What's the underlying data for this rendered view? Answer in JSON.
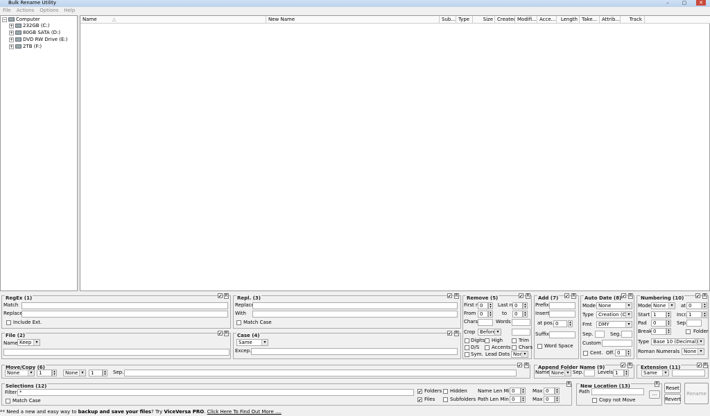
{
  "window": {
    "title": "Bulk Rename Utility",
    "controls": [
      "–",
      "▢",
      "✕"
    ]
  },
  "menu": [
    "File",
    "Actions",
    "Options",
    "Help"
  ],
  "tree": {
    "root": "Computer",
    "drives": [
      "232GB (C:)",
      "80GB SATA (D:)",
      "DVD RW Drive (E:)",
      "2TB (F:)"
    ]
  },
  "columns": [
    "Name",
    "New Name",
    "Sub...",
    "Type",
    "Size",
    "Created",
    "Modifi...",
    "Acce...",
    "Length",
    "Take...",
    "Attrib...",
    "Track"
  ],
  "regex": {
    "title": "RegEx (1)",
    "match": "Match",
    "replace": "Replace",
    "include_ext": "Include Ext."
  },
  "repl": {
    "title": "Repl. (3)",
    "replace": "Replace",
    "with": "With",
    "match_case": "Match Case"
  },
  "remove": {
    "title": "Remove (5)",
    "first_n": "First n",
    "first_val": "0",
    "last_n": "Last n",
    "last_val": "0",
    "from": "From",
    "from_val": "0",
    "to": "to",
    "to_val": "0",
    "chars": "Chars",
    "words": "Words",
    "crop": "Crop",
    "crop_val": "Before",
    "digits": "Digits",
    "high": "High",
    "trim": "Trim",
    "ds": "D/S",
    "accents": "Accents",
    "chars2": "Chars",
    "sym": "Sym.",
    "lead_dots": "Lead Dots",
    "lead_val": "Non"
  },
  "add": {
    "title": "Add (7)",
    "prefix": "Prefix",
    "insert": "Insert",
    "at_pos": "at pos.",
    "pos_val": "0",
    "suffix": "Suffix",
    "word_space": "Word Space"
  },
  "autodate": {
    "title": "Auto Date (8)",
    "mode": "Mode",
    "mode_val": "None",
    "type": "Type",
    "type_val": "Creation (Cur",
    "fmt": "Fmt",
    "fmt_val": "DMY",
    "sep": "Sep.",
    "seg": "Seg.",
    "custom": "Custom",
    "cent": "Cent.",
    "off": "Off.",
    "off_val": "0"
  },
  "numbering": {
    "title": "Numbering (10)",
    "mode": "Mode",
    "mode_val": "None",
    "at": "at",
    "at_val": "0",
    "start": "Start",
    "start_val": "1",
    "incr": "Incr.",
    "incr_val": "1",
    "pad": "Pad",
    "pad_val": "0",
    "sep": "Sep.",
    "break": "Break",
    "break_val": "0",
    "folder": "Folder",
    "type": "Type",
    "type_val": "Base 10 (Decimal)",
    "roman": "Roman Numerals",
    "roman_val": "None"
  },
  "file": {
    "title": "File (2)",
    "name": "Name",
    "name_val": "Keep"
  },
  "case": {
    "title": "Case (4)",
    "case_val": "Same",
    "excep": "Excep."
  },
  "movecopy": {
    "title": "Move/Copy (6)",
    "m1": "None",
    "v1": "1",
    "m2": "None",
    "v2": "1",
    "sep": "Sep."
  },
  "append": {
    "title": "Append Folder Name (9)",
    "name": "Name",
    "name_val": "None",
    "sep": "Sep.",
    "levels": "Levels",
    "levels_val": "1"
  },
  "extension": {
    "title": "Extension (11)",
    "val": "Same"
  },
  "selections": {
    "title": "Selections (12)",
    "filter": "Filter",
    "filter_val": "*",
    "match_case": "Match Case",
    "folders": "Folders",
    "hidden": "Hidden",
    "files": "Files",
    "subfolders": "Subfolders",
    "name_len_min": "Name Len Min",
    "nlm_val": "0",
    "max": "Max",
    "max1_val": "0",
    "path_len_min": "Path Len Min",
    "plm_val": "0",
    "max2_val": "0"
  },
  "newloc": {
    "title": "New Location (13)",
    "path": "Path",
    "browse": "...",
    "copy_not_move": "Copy not Move"
  },
  "buttons": {
    "reset": "Reset",
    "revert": "Revert",
    "rename": "Rename"
  },
  "panel_flags": {
    "r": "R"
  },
  "footer": {
    "prefix": "** Need a new and easy way to ",
    "bold1": "backup and save your files",
    "mid": "? Try ",
    "bold2": "ViceVersa PRO",
    "mid2": ". ",
    "link": "Click Here To Find Out More ...."
  }
}
